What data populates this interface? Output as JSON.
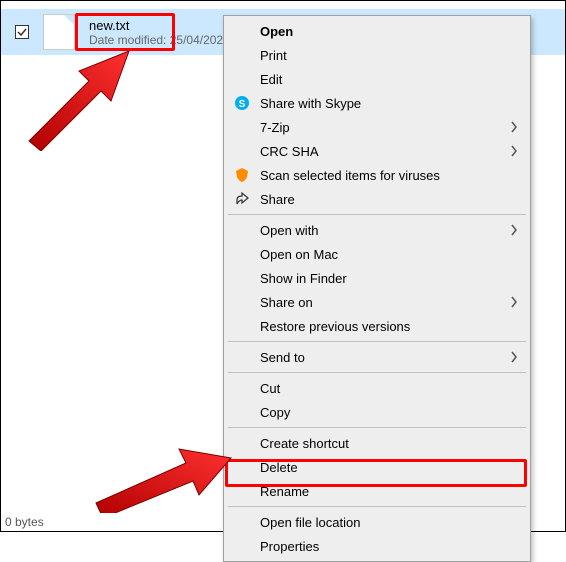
{
  "file": {
    "name": "new.txt",
    "date_label": "Date modified:",
    "date_value": "25/04/202"
  },
  "menu": {
    "open": "Open",
    "print": "Print",
    "edit": "Edit",
    "skype": "Share with Skype",
    "sevenzip": "7-Zip",
    "crcsha": "CRC SHA",
    "scan": "Scan selected items for viruses",
    "share": "Share",
    "openwith": "Open with",
    "openmac": "Open on Mac",
    "showfinder": "Show in Finder",
    "shareon": "Share on",
    "restore": "Restore previous versions",
    "sendto": "Send to",
    "cut": "Cut",
    "copy": "Copy",
    "shortcut": "Create shortcut",
    "delete": "Delete",
    "rename": "Rename",
    "openloc": "Open file location",
    "properties": "Properties"
  },
  "status": "0 bytes"
}
